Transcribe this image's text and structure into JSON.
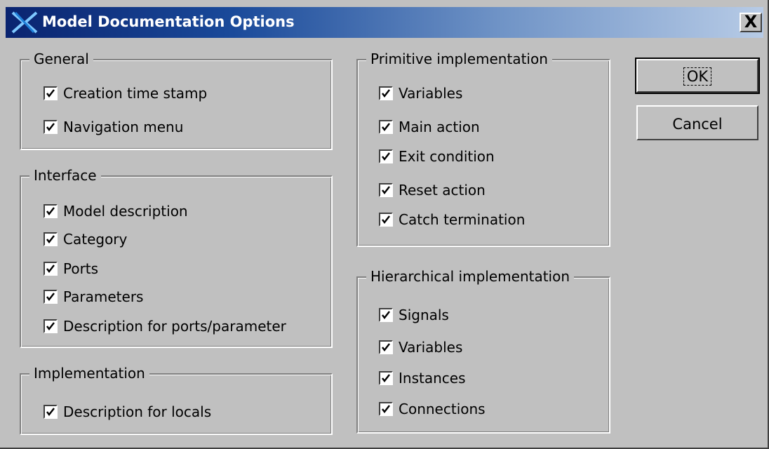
{
  "window": {
    "title": "Model Documentation Options",
    "close_label": "X"
  },
  "groups": {
    "general": {
      "legend": "General",
      "items": [
        {
          "label": "Creation time stamp",
          "checked": true
        },
        {
          "label": "Navigation menu",
          "checked": true
        }
      ]
    },
    "interface": {
      "legend": "Interface",
      "items": [
        {
          "label": "Model description",
          "checked": true
        },
        {
          "label": "Category",
          "checked": true
        },
        {
          "label": "Ports",
          "checked": true
        },
        {
          "label": "Parameters",
          "checked": true
        },
        {
          "label": "Description for ports/parameter",
          "checked": true
        }
      ]
    },
    "implementation": {
      "legend": "Implementation",
      "items": [
        {
          "label": "Description for locals",
          "checked": true
        }
      ]
    },
    "primitive": {
      "legend": "Primitive implementation",
      "items": [
        {
          "label": "Variables",
          "checked": true
        },
        {
          "label": "Main action",
          "checked": true
        },
        {
          "label": "Exit condition",
          "checked": true
        },
        {
          "label": "Reset action",
          "checked": true
        },
        {
          "label": "Catch termination",
          "checked": true
        }
      ]
    },
    "hierarchical": {
      "legend": "Hierarchical implementation",
      "items": [
        {
          "label": "Signals",
          "checked": true
        },
        {
          "label": "Variables",
          "checked": true
        },
        {
          "label": "Instances",
          "checked": true
        },
        {
          "label": "Connections",
          "checked": true
        }
      ]
    }
  },
  "buttons": {
    "ok_label": "OK",
    "cancel_label": "Cancel"
  },
  "colors": {
    "dialog_bg": "#c0c0c0",
    "titlebar_start": "#0a2470",
    "titlebar_end": "#b7cbe6"
  }
}
